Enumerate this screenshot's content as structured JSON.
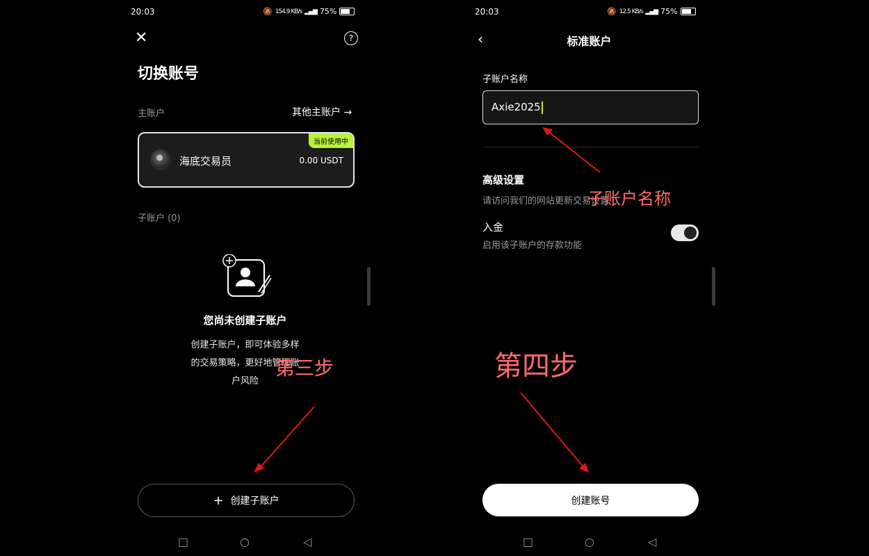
{
  "left": {
    "status": {
      "time": "20:03",
      "net_speed": "154.9 KB/s",
      "battery": "75%"
    },
    "title": "切换账号",
    "main_account_label": "主账户",
    "other_main_link": "其他主账户 →",
    "main_account": {
      "name": "海底交易员",
      "balance": "0.00 USDT",
      "badge": "当前使用中"
    },
    "sub_account_label": "子账户 (0)",
    "empty_title": "您尚未创建子账户",
    "empty_desc_1": "创建子账户，即可体验多样",
    "empty_desc_2": "的交易策略，更好地管理账",
    "empty_desc_3": "户风险",
    "annotation": "第三步",
    "create_button": "创建子账户",
    "create_icon": "plus-icon"
  },
  "right": {
    "status": {
      "time": "20:03",
      "net_speed": "12.5 KB/s",
      "battery": "75%"
    },
    "title": "标准账户",
    "sub_name_label": "子账户名称",
    "sub_name_value": "Axie2025",
    "advanced_title": "高级设置",
    "advanced_desc": "请访问我们的网站更新交易设置",
    "annotation_name": "子账户名称",
    "deposit_title": "入金",
    "deposit_desc": "启用该子账户的存款功能",
    "deposit_enabled": true,
    "annotation_step": "第四步",
    "create_button": "创建账号"
  },
  "colors": {
    "accent_green": "#b8f23c",
    "annotation_red": "#ff6b6b",
    "background": "#000000"
  }
}
